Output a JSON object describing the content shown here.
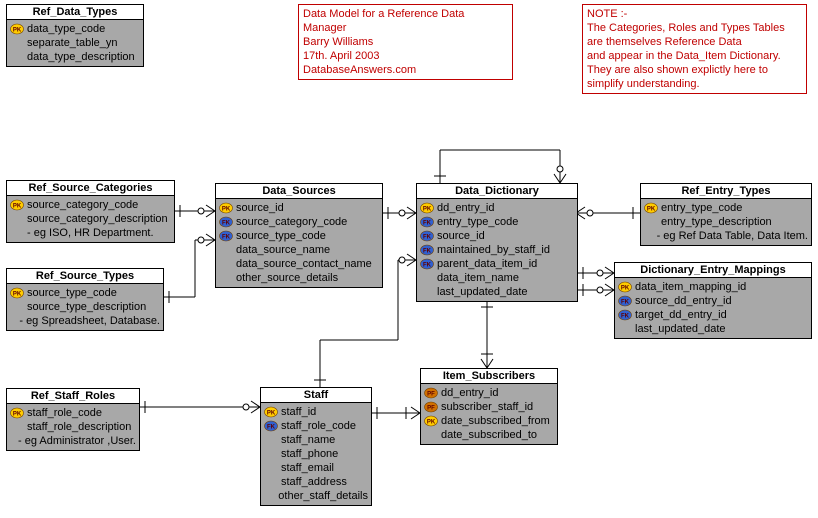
{
  "notes": {
    "a": {
      "lines": [
        "Data Model for a Reference Data Manager",
        "Barry Williams",
        "17th. April 2003",
        "DatabaseAnswers.com"
      ]
    },
    "b": {
      "lines": [
        "NOTE :-",
        "The Categories, Roles and Types Tables",
        "are themselves Reference Data",
        "and appear in the Data_Item Dictionary.",
        "They are also shown explictly here to",
        "simplify understanding."
      ]
    }
  },
  "entities": {
    "ref_data_types": {
      "title": "Ref_Data_Types",
      "cols": [
        {
          "key": "pk",
          "name": "data_type_code"
        },
        {
          "key": "",
          "name": "separate_table_yn"
        },
        {
          "key": "",
          "name": "data_type_description"
        }
      ]
    },
    "ref_source_categories": {
      "title": "Ref_Source_Categories",
      "cols": [
        {
          "key": "pk",
          "name": "source_category_code"
        },
        {
          "key": "",
          "name": "source_category_description"
        },
        {
          "key": "",
          "name": "- eg ISO, HR Department."
        }
      ]
    },
    "data_sources": {
      "title": "Data_Sources",
      "cols": [
        {
          "key": "pk",
          "name": "source_id"
        },
        {
          "key": "fk",
          "name": "source_category_code"
        },
        {
          "key": "fk",
          "name": "source_type_code"
        },
        {
          "key": "",
          "name": "data_source_name"
        },
        {
          "key": "",
          "name": "data_source_contact_name"
        },
        {
          "key": "",
          "name": "other_source_details"
        }
      ]
    },
    "data_dictionary": {
      "title": "Data_Dictionary",
      "cols": [
        {
          "key": "pk",
          "name": "dd_entry_id"
        },
        {
          "key": "fk",
          "name": "entry_type_code"
        },
        {
          "key": "fk",
          "name": "source_id"
        },
        {
          "key": "fk",
          "name": "maintained_by_staff_id"
        },
        {
          "key": "fk",
          "name": "parent_data_item_id"
        },
        {
          "key": "",
          "name": "data_item_name"
        },
        {
          "key": "",
          "name": "last_updated_date"
        }
      ]
    },
    "ref_entry_types": {
      "title": "Ref_Entry_Types",
      "cols": [
        {
          "key": "pk",
          "name": "entry_type_code"
        },
        {
          "key": "",
          "name": "entry_type_description"
        },
        {
          "key": "",
          "name": "- eg Ref Data Table, Data Item."
        }
      ]
    },
    "ref_source_types": {
      "title": "Ref_Source_Types",
      "cols": [
        {
          "key": "pk",
          "name": "source_type_code"
        },
        {
          "key": "",
          "name": "source_type_description"
        },
        {
          "key": "",
          "name": "- eg Spreadsheet, Database."
        }
      ]
    },
    "dictionary_entry_mappings": {
      "title": "Dictionary_Entry_Mappings",
      "cols": [
        {
          "key": "pk",
          "name": "data_item_mapping_id"
        },
        {
          "key": "fk",
          "name": "source_dd_entry_id"
        },
        {
          "key": "fk",
          "name": "target_dd_entry_id"
        },
        {
          "key": "",
          "name": "last_updated_date"
        }
      ]
    },
    "ref_staff_roles": {
      "title": "Ref_Staff_Roles",
      "cols": [
        {
          "key": "pk",
          "name": "staff_role_code"
        },
        {
          "key": "",
          "name": "staff_role_description"
        },
        {
          "key": "",
          "name": "- eg Administrator ,User."
        }
      ]
    },
    "staff": {
      "title": "Staff",
      "cols": [
        {
          "key": "pk",
          "name": "staff_id"
        },
        {
          "key": "fk",
          "name": "staff_role_code"
        },
        {
          "key": "",
          "name": "staff_name"
        },
        {
          "key": "",
          "name": "staff_phone"
        },
        {
          "key": "",
          "name": "staff_email"
        },
        {
          "key": "",
          "name": "staff_address"
        },
        {
          "key": "",
          "name": "other_staff_details"
        }
      ]
    },
    "item_subscribers": {
      "title": "Item_Subscribers",
      "cols": [
        {
          "key": "pf",
          "name": "dd_entry_id"
        },
        {
          "key": "pf",
          "name": "subscriber_staff_id"
        },
        {
          "key": "pk",
          "name": "date_subscribed_from"
        },
        {
          "key": "",
          "name": "date_subscribed_to"
        }
      ]
    }
  }
}
